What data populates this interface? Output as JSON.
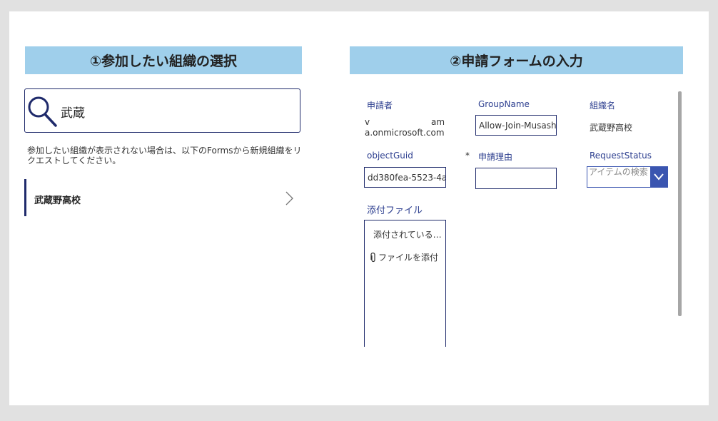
{
  "left_panel": {
    "header": "①参加したい組織の選択",
    "search": {
      "value": "武蔵"
    },
    "hint": "参加したい組織が表示されない場合は、以下のFormsから新規組織をリクエストしてください。",
    "items": [
      {
        "label": "武蔵野高校"
      }
    ]
  },
  "right_panel": {
    "header": "②申請フォームの入力",
    "applicant": {
      "label": "申請者",
      "value_line1_start": "v",
      "value_line1_end": "am",
      "value_line2": "a.onmicrosoft.com"
    },
    "group_name": {
      "label": "GroupName",
      "value": "Allow-Join-Musash"
    },
    "org_name": {
      "label": "組織名",
      "value": "武蔵野高校"
    },
    "object_guid": {
      "label": "objectGuid",
      "value": "dd380fea-5523-4a"
    },
    "reason": {
      "required_mark": "*",
      "label": "申請理由",
      "value": ""
    },
    "request_status": {
      "label": "RequestStatus",
      "placeholder": "アイテムの検索"
    },
    "attachments": {
      "label": "添付ファイル",
      "empty_text": "添付されている…",
      "attach_link": "ファイルを添付"
    }
  }
}
